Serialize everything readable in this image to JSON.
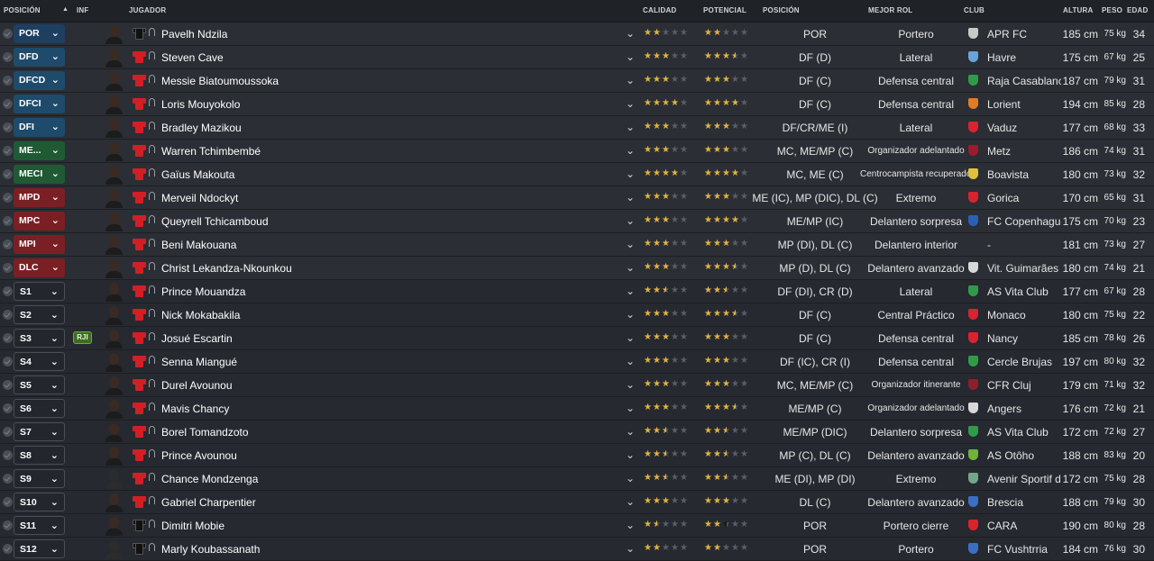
{
  "header": {
    "posicion": "POSICIÓN",
    "inf": "INF",
    "jugador": "JUGADOR",
    "calidad": "CALIDAD",
    "potencial": "POTENCIAL",
    "posicion2": "POSICIÓN",
    "mejor_rol": "MEJOR ROL",
    "club": "CLUB",
    "altura": "ALTURA",
    "peso": "PESO",
    "edad": "EDAD",
    "sort_icon": "sort-ascending-icon"
  },
  "colors": {
    "star_gold": "#e2b33e",
    "pos_goalkeeper": "#1e3f60",
    "pos_defender": "#1e4b6b",
    "pos_midfielder": "#1f5a35",
    "pos_attacker": "#7a2024",
    "shirt_red": "#d21f26",
    "inf_badge": "#3d6b22"
  },
  "players": [
    {
      "slot": "POR",
      "slot_type": "gk",
      "inf": "",
      "name": "Pavelh Ndzila",
      "shirt": "black",
      "calidad": 2,
      "potencial": 2,
      "potencial_partial": 0,
      "posicion": "POR",
      "rol": "Portero",
      "rol_small": false,
      "club": "APR FC",
      "club_color": "#c9c9c9",
      "altura": "185 cm",
      "peso": "75 kg",
      "edad": "34"
    },
    {
      "slot": "DFD",
      "slot_type": "def",
      "inf": "",
      "name": "Steven Cave",
      "shirt": "red",
      "calidad": 3,
      "potencial": 3.5,
      "potencial_partial": 0,
      "posicion": "DF (D)",
      "rol": "Lateral",
      "rol_small": false,
      "club": "Havre",
      "club_color": "#6aa3d8",
      "altura": "175 cm",
      "peso": "67 kg",
      "edad": "25"
    },
    {
      "slot": "DFCD",
      "slot_type": "def",
      "inf": "",
      "name": "Messie Biatoumoussoka",
      "shirt": "red",
      "calidad": 3,
      "potencial": 3,
      "potencial_partial": 0,
      "posicion": "DF (C)",
      "rol": "Defensa central",
      "rol_small": false,
      "club": "Raja Casablanca",
      "club_color": "#2f9b4a",
      "altura": "187 cm",
      "peso": "79 kg",
      "edad": "31"
    },
    {
      "slot": "DFCI",
      "slot_type": "def",
      "inf": "",
      "name": "Loris Mouyokolo",
      "shirt": "red",
      "calidad": 4,
      "potencial": 4,
      "potencial_partial": 0,
      "posicion": "DF (C)",
      "rol": "Defensa central",
      "rol_small": false,
      "club": "Lorient",
      "club_color": "#e37b25",
      "altura": "194 cm",
      "peso": "85 kg",
      "edad": "28"
    },
    {
      "slot": "DFI",
      "slot_type": "def",
      "inf": "",
      "name": "Bradley Mazikou",
      "shirt": "red",
      "calidad": 3,
      "potencial": 3,
      "potencial_partial": 0,
      "posicion": "DF/CR/ME (I)",
      "rol": "Lateral",
      "rol_small": false,
      "club": "Vaduz",
      "club_color": "#d9232e",
      "altura": "177 cm",
      "peso": "68 kg",
      "edad": "33"
    },
    {
      "slot": "ME...",
      "slot_type": "mid",
      "inf": "",
      "name": "Warren Tchimbembé",
      "shirt": "red",
      "calidad": 3,
      "potencial": 3,
      "potencial_partial": 0,
      "posicion": "MC, ME/MP (C)",
      "rol": "Organizador adelantado",
      "rol_small": true,
      "club": "Metz",
      "club_color": "#9c1c2e",
      "altura": "186 cm",
      "peso": "74 kg",
      "edad": "31"
    },
    {
      "slot": "MECI",
      "slot_type": "mid",
      "inf": "",
      "name": "Gaïus Makouta",
      "shirt": "red",
      "calidad": 4,
      "potencial": 4,
      "potencial_partial": 0,
      "posicion": "MC, ME (C)",
      "rol": "Centrocampista recuperador",
      "rol_small": true,
      "club": "Boavista",
      "club_color": "#e0c13a",
      "altura": "180 cm",
      "peso": "73 kg",
      "edad": "32"
    },
    {
      "slot": "MPD",
      "slot_type": "att",
      "inf": "",
      "name": "Merveil Ndockyt",
      "shirt": "red",
      "calidad": 3,
      "potencial": 3,
      "potencial_partial": 0,
      "posicion": "ME (IC), MP (DIC), DL (C)",
      "rol": "Extremo",
      "rol_small": false,
      "club": "Gorica",
      "club_color": "#d9232e",
      "altura": "170 cm",
      "peso": "65 kg",
      "edad": "31"
    },
    {
      "slot": "MPC",
      "slot_type": "att",
      "inf": "",
      "name": "Queyrell Tchicamboud",
      "shirt": "red",
      "calidad": 3,
      "potencial": 4,
      "potencial_partial": 0,
      "posicion": "ME/MP (IC)",
      "rol": "Delantero sorpresa",
      "rol_small": false,
      "club": "FC Copenhague",
      "club_color": "#2c5fb8",
      "altura": "175 cm",
      "peso": "70 kg",
      "edad": "23"
    },
    {
      "slot": "MPI",
      "slot_type": "att",
      "inf": "",
      "name": "Beni Makouana",
      "shirt": "red",
      "calidad": 3,
      "potencial": 3,
      "potencial_partial": 0,
      "posicion": "MP (DI), DL (C)",
      "rol": "Delantero interior",
      "rol_small": false,
      "club": "-",
      "club_color": "",
      "altura": "181 cm",
      "peso": "73 kg",
      "edad": "27"
    },
    {
      "slot": "DLC",
      "slot_type": "att",
      "inf": "",
      "name": "Christ Lekandza-Nkounkou",
      "shirt": "red",
      "calidad": 3,
      "potencial": 3.5,
      "potencial_partial": 0.5,
      "posicion": "MP (D), DL (C)",
      "rol": "Delantero avanzado",
      "rol_small": false,
      "club": "Vit. Guimarães",
      "club_color": "#d8d8d8",
      "altura": "180 cm",
      "peso": "74 kg",
      "edad": "21"
    },
    {
      "slot": "S1",
      "slot_type": "subs",
      "inf": "",
      "name": "Prince Mouandza",
      "shirt": "red",
      "calidad": 2.5,
      "potencial": 2.5,
      "potencial_partial": 0,
      "posicion": "DF (DI), CR (D)",
      "rol": "Lateral",
      "rol_small": false,
      "club": "AS Vita Club",
      "club_color": "#2f9b4a",
      "altura": "177 cm",
      "peso": "67 kg",
      "edad": "28"
    },
    {
      "slot": "S2",
      "slot_type": "subs",
      "inf": "",
      "name": "Nick Mokabakila",
      "shirt": "red",
      "calidad": 3,
      "potencial": 3.5,
      "potencial_partial": 0,
      "posicion": "DF (C)",
      "rol": "Central Práctico",
      "rol_small": false,
      "club": "Monaco",
      "club_color": "#d9232e",
      "altura": "180 cm",
      "peso": "75 kg",
      "edad": "22"
    },
    {
      "slot": "S3",
      "slot_type": "subs",
      "inf": "RJI",
      "name": "Josué Escartin",
      "shirt": "red",
      "calidad": 3,
      "potencial": 3,
      "potencial_partial": 0,
      "posicion": "DF (C)",
      "rol": "Defensa central",
      "rol_small": false,
      "club": "Nancy",
      "club_color": "#d9232e",
      "altura": "185 cm",
      "peso": "78 kg",
      "edad": "26"
    },
    {
      "slot": "S4",
      "slot_type": "subs",
      "inf": "",
      "name": "Senna Miangué",
      "shirt": "red",
      "calidad": 3,
      "potencial": 3,
      "potencial_partial": 0,
      "posicion": "DF (IC), CR (I)",
      "rol": "Defensa central",
      "rol_small": false,
      "club": "Cercle Brujas",
      "club_color": "#2f9b4a",
      "altura": "197 cm",
      "peso": "80 kg",
      "edad": "32"
    },
    {
      "slot": "S5",
      "slot_type": "subs",
      "inf": "",
      "name": "Durel Avounou",
      "shirt": "red",
      "calidad": 3,
      "potencial": 3,
      "potencial_partial": 0,
      "posicion": "MC, ME/MP (C)",
      "rol": "Organizador itinerante",
      "rol_small": true,
      "club": "CFR Cluj",
      "club_color": "#8c1f2c",
      "altura": "179 cm",
      "peso": "71 kg",
      "edad": "32"
    },
    {
      "slot": "S6",
      "slot_type": "subs",
      "inf": "",
      "name": "Mavis Chancy",
      "shirt": "red",
      "calidad": 3,
      "potencial": 3.5,
      "potencial_partial": 0.5,
      "posicion": "ME/MP (C)",
      "rol": "Organizador adelantado",
      "rol_small": true,
      "club": "Angers",
      "club_color": "#d8d8d8",
      "altura": "176 cm",
      "peso": "72 kg",
      "edad": "21"
    },
    {
      "slot": "S7",
      "slot_type": "subs",
      "inf": "",
      "name": "Borel Tomandzoto",
      "shirt": "red",
      "calidad": 2.5,
      "potencial": 2.5,
      "potencial_partial": 0,
      "posicion": "ME/MP (DIC)",
      "rol": "Delantero sorpresa",
      "rol_small": false,
      "club": "AS Vita Club",
      "club_color": "#2f9b4a",
      "altura": "172 cm",
      "peso": "72 kg",
      "edad": "27"
    },
    {
      "slot": "S8",
      "slot_type": "subs",
      "inf": "",
      "name": "Prince Avounou",
      "shirt": "red",
      "calidad": 2.5,
      "potencial": 2.5,
      "potencial_partial": 0.5,
      "posicion": "MP (C), DL (C)",
      "rol": "Delantero avanzado",
      "rol_small": false,
      "club": "AS Otôho",
      "club_color": "#6fb33a",
      "altura": "188 cm",
      "peso": "83 kg",
      "edad": "20"
    },
    {
      "slot": "S9",
      "slot_type": "subs",
      "inf": "",
      "name": "Chance Mondzenga",
      "shirt": "red",
      "calidad": 2.5,
      "potencial": 2.5,
      "potencial_partial": 0,
      "posicion": "ME (DI), MP (DI)",
      "rol": "Extremo",
      "rol_small": false,
      "club": "Avenir Sportif de Lo",
      "club_color": "#6fa88a",
      "altura": "172 cm",
      "peso": "75 kg",
      "edad": "28"
    },
    {
      "slot": "S10",
      "slot_type": "subs",
      "inf": "",
      "name": "Gabriel Charpentier",
      "shirt": "red",
      "calidad": 3,
      "potencial": 3,
      "potencial_partial": 0,
      "posicion": "DL (C)",
      "rol": "Delantero avanzado",
      "rol_small": false,
      "club": "Brescia",
      "club_color": "#3b6fc4",
      "altura": "188 cm",
      "peso": "79 kg",
      "edad": "30"
    },
    {
      "slot": "S11",
      "slot_type": "subs",
      "inf": "",
      "name": "Dimitri Mobie",
      "shirt": "black",
      "calidad": 1.5,
      "potencial": 2,
      "potencial_partial": 0.5,
      "posicion": "POR",
      "rol": "Portero cierre",
      "rol_small": false,
      "club": "CARA",
      "club_color": "#d9232e",
      "altura": "190 cm",
      "peso": "80 kg",
      "edad": "28"
    },
    {
      "slot": "S12",
      "slot_type": "subs",
      "inf": "",
      "name": "Marly Koubassanath",
      "shirt": "black",
      "calidad": 2,
      "potencial": 2,
      "potencial_partial": 0,
      "posicion": "POR",
      "rol": "Portero",
      "rol_small": false,
      "club": "FC Vushtrria",
      "club_color": "#3b6fc4",
      "altura": "184 cm",
      "peso": "76 kg",
      "edad": "30"
    }
  ]
}
